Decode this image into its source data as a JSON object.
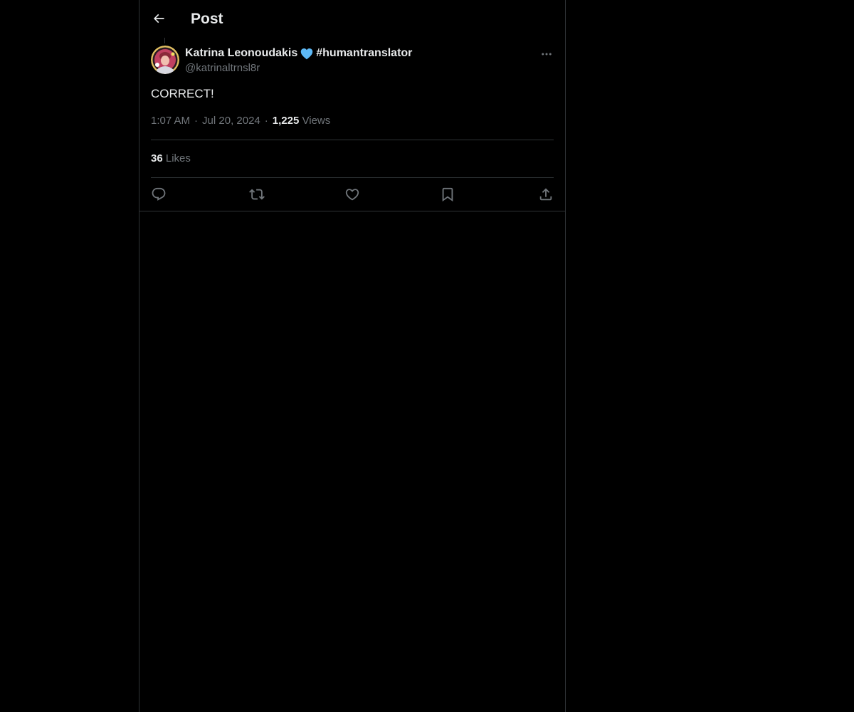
{
  "header": {
    "title": "Post",
    "back_icon": "arrow-left-icon"
  },
  "post": {
    "author": {
      "display_name": "Katrina Leonoudakis",
      "badge_icon": "blue-heart-icon",
      "hashtag": "#humantranslator",
      "handle": "@katrinaltrnsl8r"
    },
    "text": "CORRECT!",
    "time": "1:07 AM",
    "date": "Jul 20, 2024",
    "separator": "·",
    "views_count": "1,225",
    "views_label": "Views",
    "likes_count": "36",
    "likes_label": "Likes"
  },
  "actions": [
    {
      "name": "reply",
      "icon": "reply-icon"
    },
    {
      "name": "repost",
      "icon": "repost-icon"
    },
    {
      "name": "like",
      "icon": "heart-icon"
    },
    {
      "name": "bookmark",
      "icon": "bookmark-icon"
    },
    {
      "name": "share",
      "icon": "share-icon"
    }
  ],
  "colors": {
    "background": "#000000",
    "text_primary": "#e7e9ea",
    "text_secondary": "#71767b",
    "border": "#2f3336",
    "heart_badge": "#5db8f5"
  }
}
